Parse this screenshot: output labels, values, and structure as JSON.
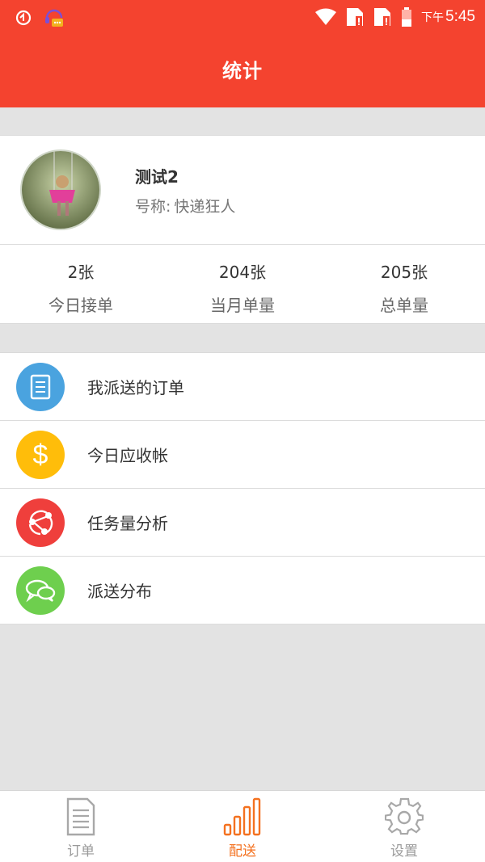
{
  "status_bar": {
    "time_prefix": "下午",
    "time": "5:45"
  },
  "header": {
    "title": "统计"
  },
  "profile": {
    "name": "测试2",
    "title_label": "号称:",
    "title_value": "快递狂人"
  },
  "stats": [
    {
      "value": "2张",
      "label": "今日接单"
    },
    {
      "value": "204张",
      "label": "当月单量"
    },
    {
      "value": "205张",
      "label": "总单量"
    }
  ],
  "menu": [
    {
      "label": "我派送的订单",
      "icon": "document-icon",
      "color": "#4aa3df"
    },
    {
      "label": "今日应收帐",
      "icon": "dollar-icon",
      "color": "#ffbd0a"
    },
    {
      "label": "任务量分析",
      "icon": "share-nodes-icon",
      "color": "#ef3f3c"
    },
    {
      "label": "派送分布",
      "icon": "chat-bubbles-icon",
      "color": "#6ecf4e"
    }
  ],
  "tabs": [
    {
      "label": "订单",
      "icon": "order-list-icon",
      "active": false
    },
    {
      "label": "配送",
      "icon": "bar-chart-icon",
      "active": true
    },
    {
      "label": "设置",
      "icon": "gear-icon",
      "active": false
    }
  ],
  "colors": {
    "brand_red": "#f4432f",
    "active_tab": "#f4711f",
    "inactive_tab": "#9a9a9a"
  }
}
